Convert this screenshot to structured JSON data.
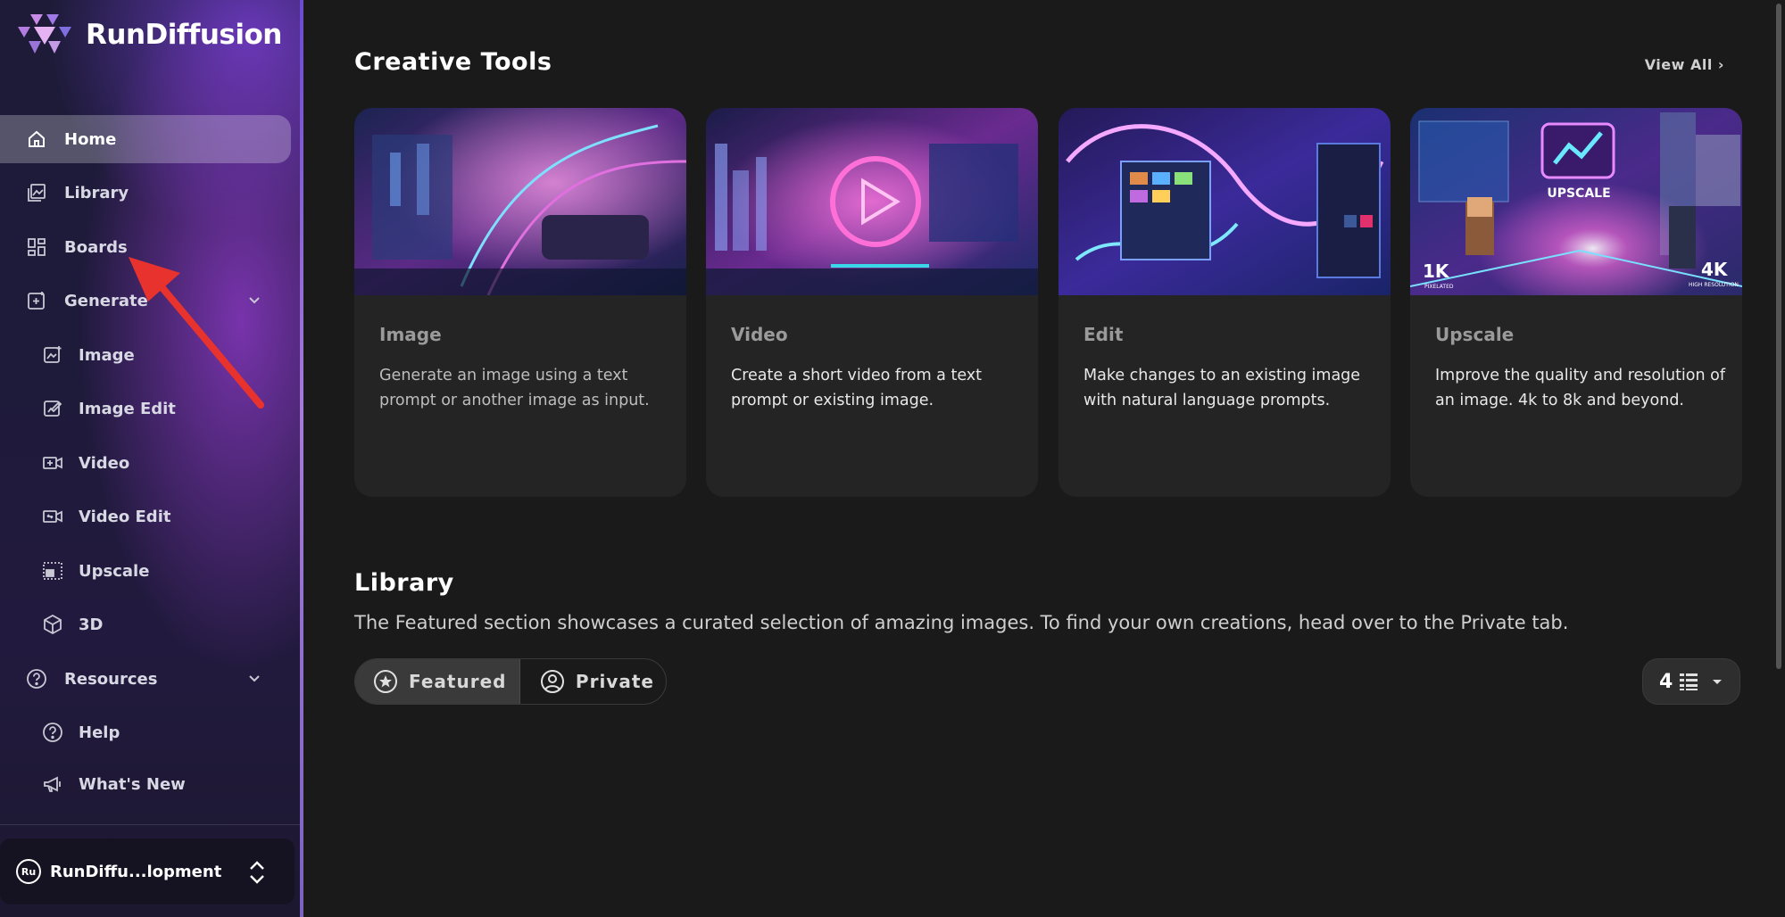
{
  "brand": {
    "name": "RunDiffusion"
  },
  "sidebar": {
    "items": [
      {
        "label": "Home",
        "icon": "home-icon",
        "active": true
      },
      {
        "label": "Library",
        "icon": "library-icon"
      },
      {
        "label": "Boards",
        "icon": "boards-icon"
      },
      {
        "label": "Generate",
        "icon": "generate-icon",
        "expandable": true
      },
      {
        "label": "Image",
        "icon": "image-icon"
      },
      {
        "label": "Image Edit",
        "icon": "image-edit-icon"
      },
      {
        "label": "Video",
        "icon": "video-icon"
      },
      {
        "label": "Video Edit",
        "icon": "video-edit-icon"
      },
      {
        "label": "Upscale",
        "icon": "upscale-icon"
      },
      {
        "label": "3D",
        "icon": "cube-icon"
      },
      {
        "label": "Resources",
        "icon": "help-circle-icon",
        "expandable": true
      },
      {
        "label": "Help",
        "icon": "question-icon"
      },
      {
        "label": "What's New",
        "icon": "megaphone-icon"
      }
    ],
    "workspace": {
      "avatar": "Ru",
      "name": "RunDiffu...lopment"
    }
  },
  "creative_tools": {
    "title": "Creative Tools",
    "view_all": "View All",
    "cards": [
      {
        "title": "Image",
        "description": "Generate an image using a text prompt or another image as input."
      },
      {
        "title": "Video",
        "description": "Create a short video from a text prompt or existing image."
      },
      {
        "title": "Edit",
        "description": "Make changes to an existing image with natural language prompts."
      },
      {
        "title": "Upscale",
        "description": "Improve the quality and resolution of an image. 4k to 8k and beyond.",
        "image_text": {
          "badge": "UPSCALE",
          "left": "1K",
          "left_sub": "PIXELATED",
          "right": "4K",
          "right_sub": "HIGH RESOLUTION"
        }
      }
    ]
  },
  "library": {
    "title": "Library",
    "description": "The Featured section showcases a curated selection of amazing images. To find your own creations, head over to the Private tab.",
    "tabs": [
      {
        "label": "Featured",
        "active": true
      },
      {
        "label": "Private"
      }
    ],
    "columns": "4"
  },
  "colors": {
    "accent": "#8a4fd8",
    "background": "#1a1a1a",
    "card": "#242424",
    "annotation": "#e8322e"
  }
}
